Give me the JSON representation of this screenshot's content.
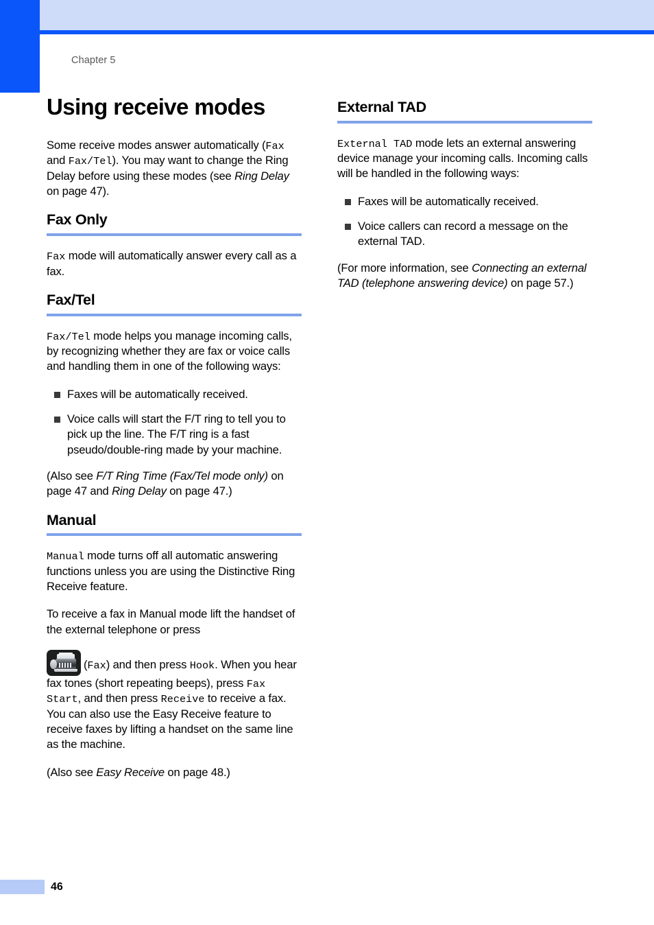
{
  "page": {
    "chapter_label": "Chapter 5",
    "page_number": "46",
    "accent_dark_blue": "#0a56fb",
    "accent_light_blue": "#cedcfa",
    "rule_blue": "#7fa3ea",
    "footer_block_blue": "#b6cbf7"
  },
  "left_column": {
    "title": "Using receive modes",
    "intro": {
      "p1a": "Some receive modes answer automatically (",
      "mono1": "Fax",
      "p1b": " and ",
      "mono2": "Fax/Tel",
      "p1c": "). You may want to change the Ring Delay before using these modes (see ",
      "italic1": "Ring Delay",
      "p1d": " on page 47)."
    },
    "fax_only": {
      "heading": "Fax Only",
      "mono1": "Fax",
      "body": " mode will automatically answer every call as a fax."
    },
    "fax_tel": {
      "heading": "Fax/Tel",
      "mono1": "Fax/Tel",
      "body": " mode helps you manage incoming calls, by recognizing whether they are fax or voice calls and handling them in one of the following ways:",
      "bullets": [
        "Faxes will be automatically received.",
        "Voice calls will start the F/T ring to tell you to pick up the line. The F/T ring is a fast pseudo/double-ring made by your machine."
      ],
      "note_a": "(Also see ",
      "note_italic1": "F/T Ring Time (Fax/Tel mode only)",
      "note_b": " on page 47 and ",
      "note_italic2": "Ring Delay",
      "note_c": " on page 47.)"
    },
    "manual": {
      "heading": "Manual",
      "mono1": "Manual",
      "p1": " mode turns off all automatic answering functions unless you are using the Distinctive Ring Receive feature.",
      "p2": "To receive a fax in Manual mode lift the handset of the external telephone or press",
      "icon_name": "fax-key-icon",
      "p3a": "(",
      "mono_fax": "Fax",
      "p3b": ") and then press ",
      "mono_hook": "Hook",
      "p3c": ". When you hear fax tones (short repeating beeps), press ",
      "mono_faxstart": "Fax Start",
      "p3d": ", and then press ",
      "mono_receive": "Receive",
      "p3e": " to receive a fax. You can also use the Easy Receive feature to receive faxes by lifting a handset on the same line as the machine.",
      "note_a": "(Also see ",
      "note_italic": "Easy Receive",
      "note_b": " on page 48.)"
    }
  },
  "right_column": {
    "external_tad": {
      "heading": "External TAD",
      "mono1": "External TAD",
      "body": " mode lets an external answering device manage your incoming calls. Incoming calls will be handled in the following ways:",
      "bullets": [
        "Faxes will be automatically received.",
        "Voice callers can record a message on the external TAD."
      ],
      "note_a": "(For more information, see ",
      "note_italic": "Connecting an external TAD (telephone answering device)",
      "note_b": " on page 57.)"
    }
  }
}
